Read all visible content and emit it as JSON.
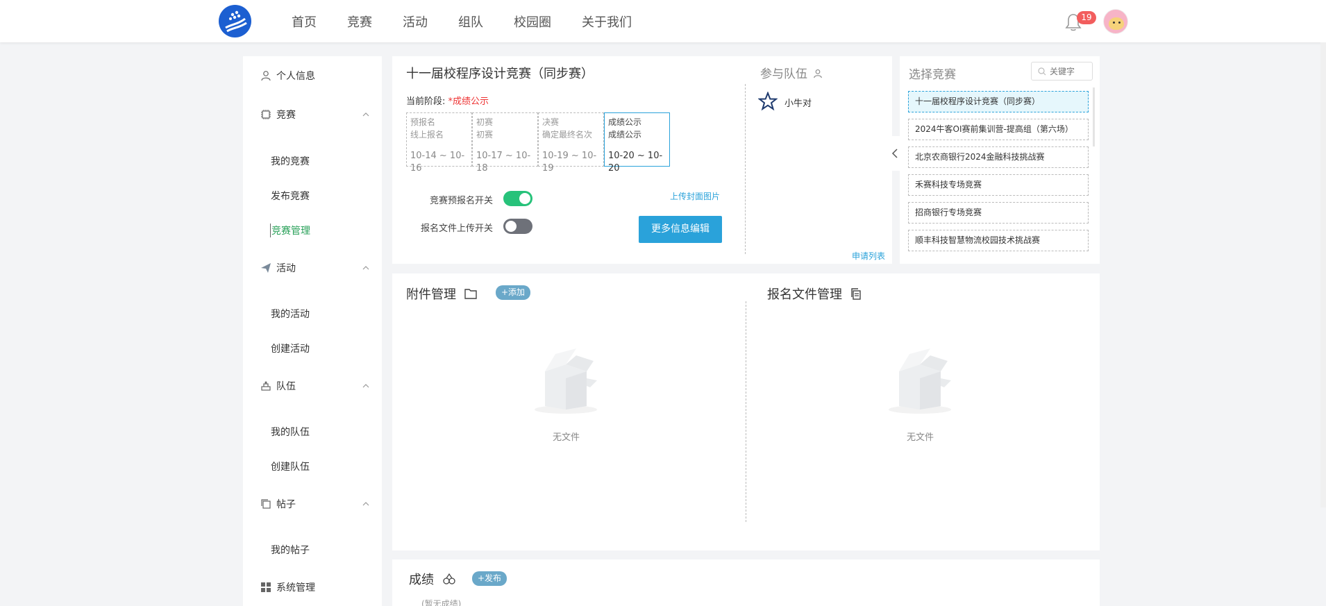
{
  "nav": {
    "items": [
      "首页",
      "竞赛",
      "活动",
      "组队",
      "校园圈",
      "关于我们"
    ],
    "notification_count": "19"
  },
  "sidebar": {
    "profile": "个人信息",
    "competition": {
      "label": "竞赛",
      "items": [
        "我的竞赛",
        "发布竞赛",
        "竞赛管理"
      ]
    },
    "activity": {
      "label": "活动",
      "items": [
        "我的活动",
        "创建活动"
      ]
    },
    "team": {
      "label": "队伍",
      "items": [
        "我的队伍",
        "创建队伍"
      ]
    },
    "posts": {
      "label": "帖子",
      "items": [
        "我的帖子"
      ]
    },
    "system": "系统管理"
  },
  "competition_card": {
    "title": "十一届校程序设计竞赛（同步赛）",
    "phase_label": "当前阶段:",
    "phase_value": "*成绩公示",
    "stages": [
      {
        "name": "预报名",
        "desc": "线上报名",
        "dates": "10-14 ~ 10-16"
      },
      {
        "name": "初赛",
        "desc": "初赛",
        "dates": "10-17 ~ 10-18"
      },
      {
        "name": "决赛",
        "desc": "确定最终名次",
        "dates": "10-19 ~ 10-19"
      },
      {
        "name": "成绩公示",
        "desc": "成绩公示",
        "dates": "10-20 ~ 10-20"
      }
    ],
    "prereg_switch_label": "竞赛预报名开关",
    "upload_switch_label": "报名文件上传开关",
    "upload_cover_link": "上传封面图片",
    "more_edit_button": "更多信息编辑",
    "prereg_on": true,
    "upload_on": false
  },
  "teams_card": {
    "title": "参与队伍",
    "team_name": "小牛对",
    "apply_list_link": "申请列表"
  },
  "select_card": {
    "title": "选择竞赛",
    "search_placeholder": "关键字",
    "items": [
      "十一届校程序设计竞赛（同步赛）",
      "2024牛客OI赛前集训营-提高组（第六场）",
      "北京农商银行2024金融科技挑战赛",
      "禾赛科技专场竞赛",
      "招商银行专场竞赛",
      "顺丰科技智慧物流校园技术挑战赛"
    ]
  },
  "files_card": {
    "attachments_title": "附件管理",
    "add_button": "+添加",
    "empty_text_left": "无文件",
    "registration_files_title": "报名文件管理",
    "empty_text_right": "无文件"
  },
  "scores_card": {
    "title": "成绩",
    "publish_button": "+发布",
    "empty_text": "(暂无成绩)"
  },
  "colors": {
    "accent": "#2aa2da",
    "green": "#2aa15a",
    "toggle_on": "#27c27a",
    "red": "#e33333"
  }
}
